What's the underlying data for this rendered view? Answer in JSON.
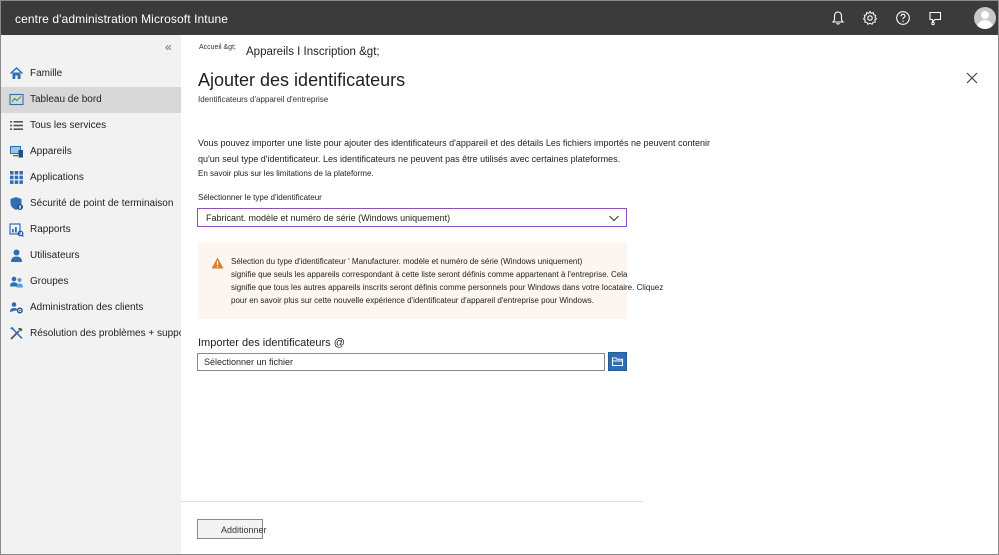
{
  "topbar": {
    "title": "centre d'administration Microsoft Intune",
    "icons": [
      "bell-icon",
      "gear-icon",
      "help-icon",
      "feedback-icon",
      "avatar"
    ]
  },
  "sidebar": {
    "collapse": "«",
    "items": [
      {
        "label": "Famille",
        "icon": "home-icon",
        "active": false
      },
      {
        "label": "Tableau de bord",
        "icon": "dashboard-icon",
        "active": true
      },
      {
        "label": "Tous les services",
        "icon": "list-icon",
        "active": false
      },
      {
        "label": "Appareils",
        "icon": "devices-icon",
        "active": false
      },
      {
        "label": "Applications",
        "icon": "apps-grid-icon",
        "active": false
      },
      {
        "label": "Sécurité de point de terminaison",
        "icon": "shield-icon",
        "active": false
      },
      {
        "label": "Rapports",
        "icon": "reports-icon",
        "active": false
      },
      {
        "label": "Utilisateurs",
        "icon": "user-icon",
        "active": false
      },
      {
        "label": "Groupes",
        "icon": "groups-icon",
        "active": false
      },
      {
        "label": "Administration des clients",
        "icon": "tenant-gear-icon",
        "active": false
      },
      {
        "label": "Résolution des problèmes + support",
        "icon": "tools-icon",
        "active": false
      }
    ]
  },
  "main": {
    "breadcrumb_small": "Accueil &gt;",
    "breadcrumb": "Appareils I Inscription &gt;",
    "title": "Ajouter des identificateurs",
    "subtitle": "Identificateurs d'appareil d'entreprise",
    "description_line1": "Vous pouvez importer une liste pour ajouter des identificateurs d'appareil et des détails Les fichiers importés ne peuvent contenir",
    "description_line2": "qu'un seul type d'identificateur. Les identificateurs ne peuvent pas être utilisés avec certaines plateformes.",
    "description_line3": "En savoir plus sur les limitations de la plateforme.",
    "select_label": "Sélectionner le type d'identificateur",
    "select_value": "Fabricant. modèle et numéro de série (Windows uniquement)",
    "warning_lines": [
      "Sélection du type d'identificateur ' Manufacturer. modèle et numéro de série (Windows uniquement)",
      "signifie que seuls les appareils correspondant à cette liste seront définis comme appartenant à l'entreprise. Cela",
      "signifie que tous les autres appareils inscrits seront définis comme personnels pour Windows dans votre locataire. Cliquez",
      "pour en savoir plus sur cette nouvelle expérience d'identificateur d'appareil d'entreprise pour Windows."
    ],
    "import_label": "Importer des identificateurs @",
    "file_placeholder": "Sélectionner un fichier",
    "add_button": "Additionner"
  },
  "colors": {
    "topbar_bg": "#3b3b3b",
    "sidebar_bg": "#f2f2f2",
    "active_item_bg": "#d8d8d8",
    "accent_blue": "#2f6db5",
    "select_border": "#8e4fbf",
    "warning_bg": "#fdf6f0",
    "warning_icon": "#d9822b"
  }
}
